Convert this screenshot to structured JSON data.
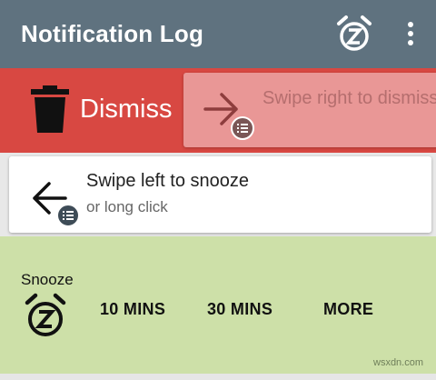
{
  "app": {
    "title": "Notification Log",
    "toolbar": {
      "snooze_icon": "alarm-snooze-icon",
      "menu_icon": "more-vert-icon"
    }
  },
  "dismiss_row": {
    "label": "Dismiss",
    "icon": "trash-icon",
    "background": "#d84842",
    "card": {
      "text": "Swipe right to dismiss",
      "icon": "arrow-right-icon",
      "badge_icon": "notification-list-icon"
    }
  },
  "snooze_hint": {
    "title": "Swipe left to snooze",
    "subtitle": "or long click",
    "icon": "arrow-left-icon",
    "badge_icon": "notification-list-icon"
  },
  "snooze_row": {
    "label": "Snooze",
    "icon": "alarm-snooze-icon",
    "background": "#cde0a8",
    "options": [
      "10 MINS",
      "30 MINS",
      "MORE"
    ]
  },
  "watermark": "wsxdn.com",
  "colors": {
    "appbar": "#5f727f",
    "dismiss": "#d84842",
    "snooze": "#cde0a8"
  }
}
